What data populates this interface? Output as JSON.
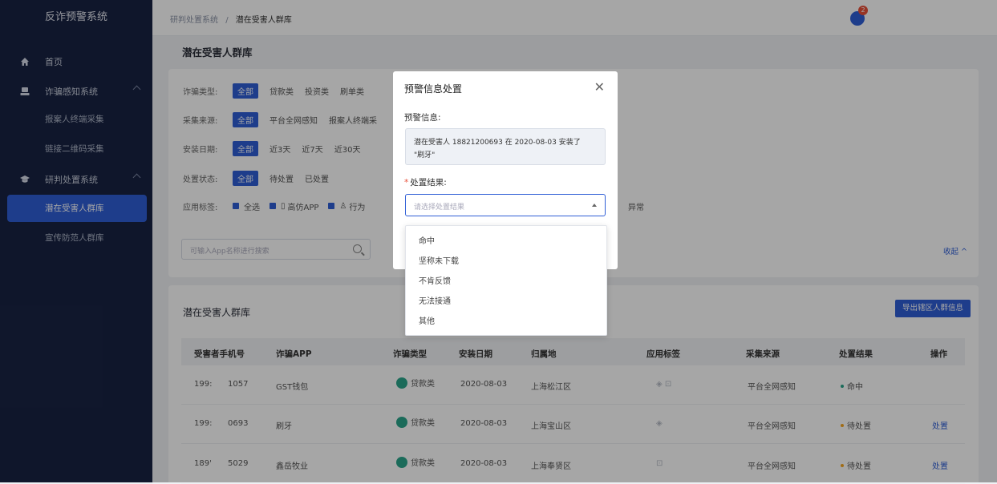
{
  "sidebar": {
    "brand": "反诈预警系统",
    "home": "首页",
    "groups": [
      {
        "label": "诈骗感知系统",
        "items": [
          "报案人终端采集",
          "链接二维码采集"
        ]
      },
      {
        "label": "研判处置系统",
        "items": [
          "潜在受害人群库",
          "宣传防范人群库"
        ]
      }
    ]
  },
  "header": {
    "crumb_root": "研判处置系统",
    "crumb_sep": "/",
    "crumb_current": "潜在受害人群库",
    "badge": "2"
  },
  "page_title": "潜在受害人群库",
  "filters": {
    "fraud_type": {
      "label": "诈骗类型:",
      "options": [
        "全部",
        "贷款类",
        "投资类",
        "刷单类"
      ]
    },
    "source": {
      "label": "采集来源:",
      "options": [
        "全部",
        "平台全网感知",
        "报案人终端采"
      ]
    },
    "install_date": {
      "label": "安装日期:",
      "options": [
        "全部",
        "近3天",
        "近7天",
        "近30天"
      ]
    },
    "status": {
      "label": "处置状态:",
      "options": [
        "全部",
        "待处置",
        "已处置"
      ]
    },
    "tags": {
      "label": "应用标签:",
      "options": [
        "全选",
        "高仿APP",
        "行为",
        "异常"
      ]
    },
    "search_placeholder": "可输入App名称进行搜索",
    "collapse": "收起"
  },
  "table": {
    "title": "潜在受害人群库",
    "export": "导出辖区人群信息",
    "headers": [
      "受害者手机号",
      "诈骗APP",
      "诈骗类型",
      "安装日期",
      "归属地",
      "应用标签",
      "采集来源",
      "处置结果",
      "操作"
    ],
    "rows": [
      {
        "phone_a": "199:",
        "phone_b": "1057",
        "app": "GST钱包",
        "type": "贷款类",
        "date": "2020-08-03",
        "region": "上海松江区",
        "tags": "◈ ⊡",
        "source": "平台全网感知",
        "status": "命中",
        "status_color": "#2aa58a",
        "op": ""
      },
      {
        "phone_a": "199:",
        "phone_b": "0693",
        "app": "刷牙",
        "type": "贷款类",
        "date": "2020-08-03",
        "region": "上海宝山区",
        "tags": "◈",
        "source": "平台全网感知",
        "status": "待处置",
        "status_color": "#f5a623",
        "op": "处置"
      },
      {
        "phone_a": "189'",
        "phone_b": "5029",
        "app": "鑫岳牧业",
        "type": "贷款类",
        "date": "2020-08-03",
        "region": "上海奉贤区",
        "tags": "⊡",
        "source": "平台全网感知",
        "status": "待处置",
        "status_color": "#f5a623",
        "op": "处置"
      }
    ]
  },
  "modal": {
    "title": "预警信息处置",
    "close": "✕",
    "info_label": "预警信息:",
    "info_line1": "潜在受害人 18821200693 在 2020-08-03 安装了",
    "info_line2": "\"刷牙\"",
    "result_label": "处置结果:",
    "result_required": "*",
    "select_placeholder": "请选择处置结果",
    "options": [
      "命中",
      "坚称未下载",
      "不肯反馈",
      "无法接通",
      "其他"
    ]
  }
}
